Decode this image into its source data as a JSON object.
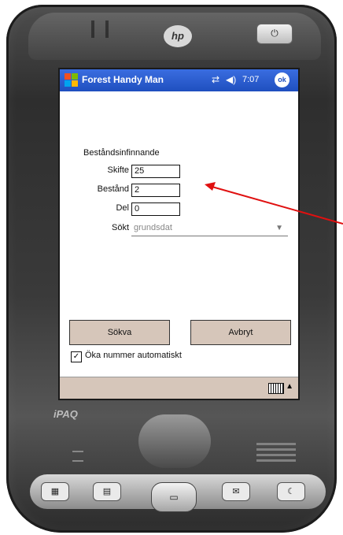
{
  "device": {
    "brand_logo": "hp",
    "model_logo": "iPAQ"
  },
  "titlebar": {
    "title": "Forest Handy Man",
    "time": "7:07",
    "ok_label": "ok",
    "icons": [
      "windows-flag-icon",
      "connectivity-icon",
      "volume-icon"
    ]
  },
  "form": {
    "heading": "Beståndsinfinnande",
    "fields": [
      {
        "label": "Skifte",
        "value": "25"
      },
      {
        "label": "Bestånd",
        "value": "2"
      },
      {
        "label": "Del",
        "value": "0"
      },
      {
        "label": "Sökt",
        "value": "grundsdat"
      }
    ]
  },
  "buttons": {
    "search": "Sökva",
    "cancel": "Avbryt"
  },
  "checkbox": {
    "label": "Öka nummer automatiskt",
    "checked": true
  },
  "colors": {
    "titlebar": "#2350c8",
    "menubar": "#d6c6ba",
    "annotation_arrow": "#e01010"
  }
}
